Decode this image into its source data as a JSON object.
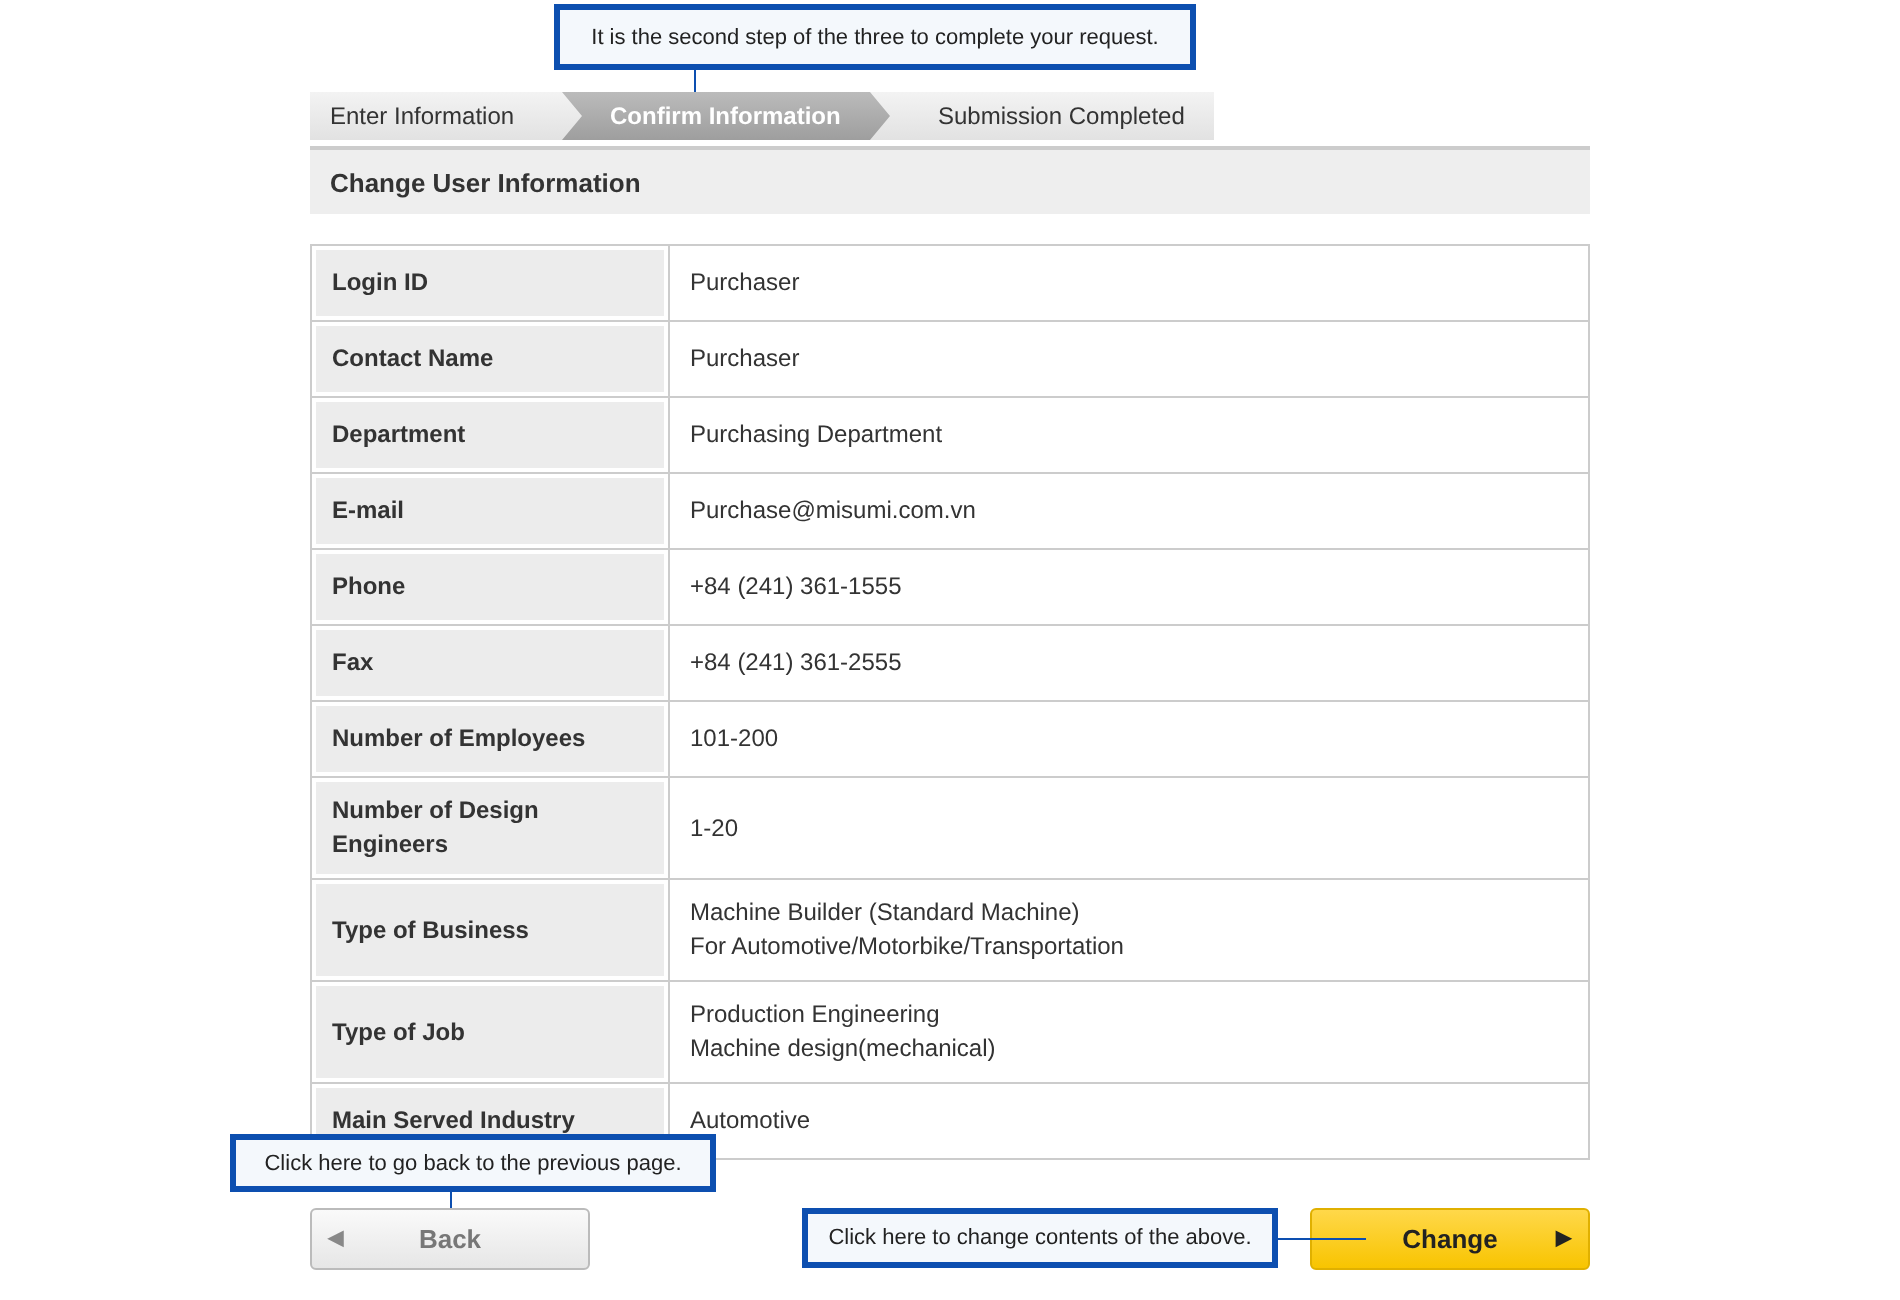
{
  "steps_callout": "It is the second step of the three to complete your request.",
  "steps": [
    {
      "label": "Enter Information",
      "selected": false
    },
    {
      "label": "Confirm Information",
      "selected": true
    },
    {
      "label": "Submission Completed",
      "selected": false
    }
  ],
  "section_title": "Change User Information",
  "table": {
    "rows": [
      {
        "label": "Login ID",
        "value": "Purchaser"
      },
      {
        "label": "Contact Name",
        "value": "Purchaser"
      },
      {
        "label": "Department",
        "value": "Purchasing Department"
      },
      {
        "label": "E-mail",
        "value": "Purchase@misumi.com.vn"
      },
      {
        "label": "Phone",
        "value": "+84 (241) 361-1555"
      },
      {
        "label": "Fax",
        "value": "+84 (241) 361-2555"
      },
      {
        "label": "Number of Employees",
        "value": "101-200"
      },
      {
        "label": "Number of Design Engineers",
        "value": "1-20"
      },
      {
        "label": "Type of Business",
        "value": "Machine Builder (Standard Machine)\nFor Automotive/Motorbike/Transportation"
      },
      {
        "label": "Type of Job",
        "value": "Production Engineering\nMachine design(mechanical)"
      },
      {
        "label": "Main Served Industry",
        "value": "Automotive"
      }
    ]
  },
  "back_callout": "Click here to go back to the previous page.",
  "back_button": {
    "icon": "◀",
    "label": "Back"
  },
  "change_callout": "Click here to change contents of the above.",
  "change_button": {
    "label": "Change",
    "icon": "▶"
  }
}
